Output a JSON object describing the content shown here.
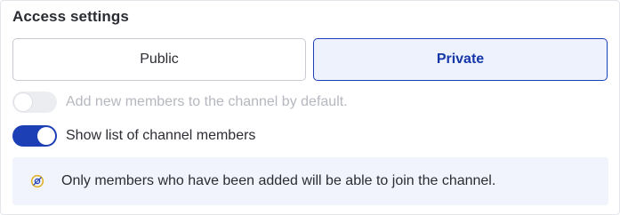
{
  "section": {
    "title": "Access settings"
  },
  "access_type": {
    "options": [
      {
        "label": "Public",
        "selected": false
      },
      {
        "label": "Private",
        "selected": true
      }
    ]
  },
  "settings": [
    {
      "label": "Add new members to the channel by default.",
      "enabled": false,
      "disabled": true
    },
    {
      "label": "Show list of channel members",
      "enabled": true,
      "disabled": false
    }
  ],
  "notice": {
    "icon": "info-icon",
    "text": "Only members who have been added will be able to join the channel."
  },
  "colors": {
    "accent": "#1d3fb5",
    "selected_bg": "#eef2fd",
    "notice_bg": "#f1f4fd",
    "disabled_text": "#b5b8bf",
    "icon_yellow": "#e2b32d"
  }
}
